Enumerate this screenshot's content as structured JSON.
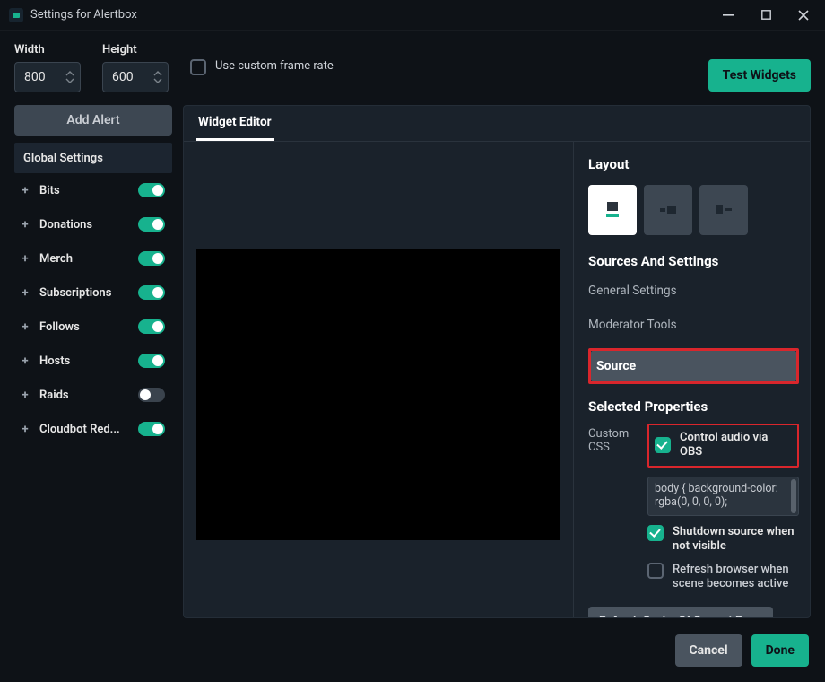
{
  "window": {
    "title": "Settings for Alertbox"
  },
  "top": {
    "width_label": "Width",
    "width_value": "800",
    "height_label": "Height",
    "height_value": "600",
    "custom_frame_label": "Use custom frame rate",
    "test_widgets": "Test Widgets"
  },
  "sidebar": {
    "add_alert": "Add Alert",
    "global_header": "Global Settings",
    "items": [
      {
        "label": "Bits",
        "on": true
      },
      {
        "label": "Donations",
        "on": true
      },
      {
        "label": "Merch",
        "on": true
      },
      {
        "label": "Subscriptions",
        "on": true
      },
      {
        "label": "Follows",
        "on": true
      },
      {
        "label": "Hosts",
        "on": true
      },
      {
        "label": "Raids",
        "on": false
      },
      {
        "label": "Cloudbot Red...",
        "on": true
      }
    ]
  },
  "editor": {
    "tab": "Widget Editor"
  },
  "right": {
    "layout_h": "Layout",
    "sources_h": "Sources And Settings",
    "links": {
      "general": "General Settings",
      "moderator": "Moderator Tools",
      "source": "Source"
    },
    "selected_h": "Selected Properties",
    "custom_css_label": "Custom CSS",
    "custom_css_value": "body { background-color: rgba(0, 0, 0, 0);",
    "control_audio": "Control audio via OBS",
    "shutdown": "Shutdown source when not visible",
    "refresh_browser": "Refresh browser when scene becomes active",
    "refresh_cache_btn": "Refresh Cache Of Current Page"
  },
  "footer": {
    "cancel": "Cancel",
    "done": "Done"
  }
}
